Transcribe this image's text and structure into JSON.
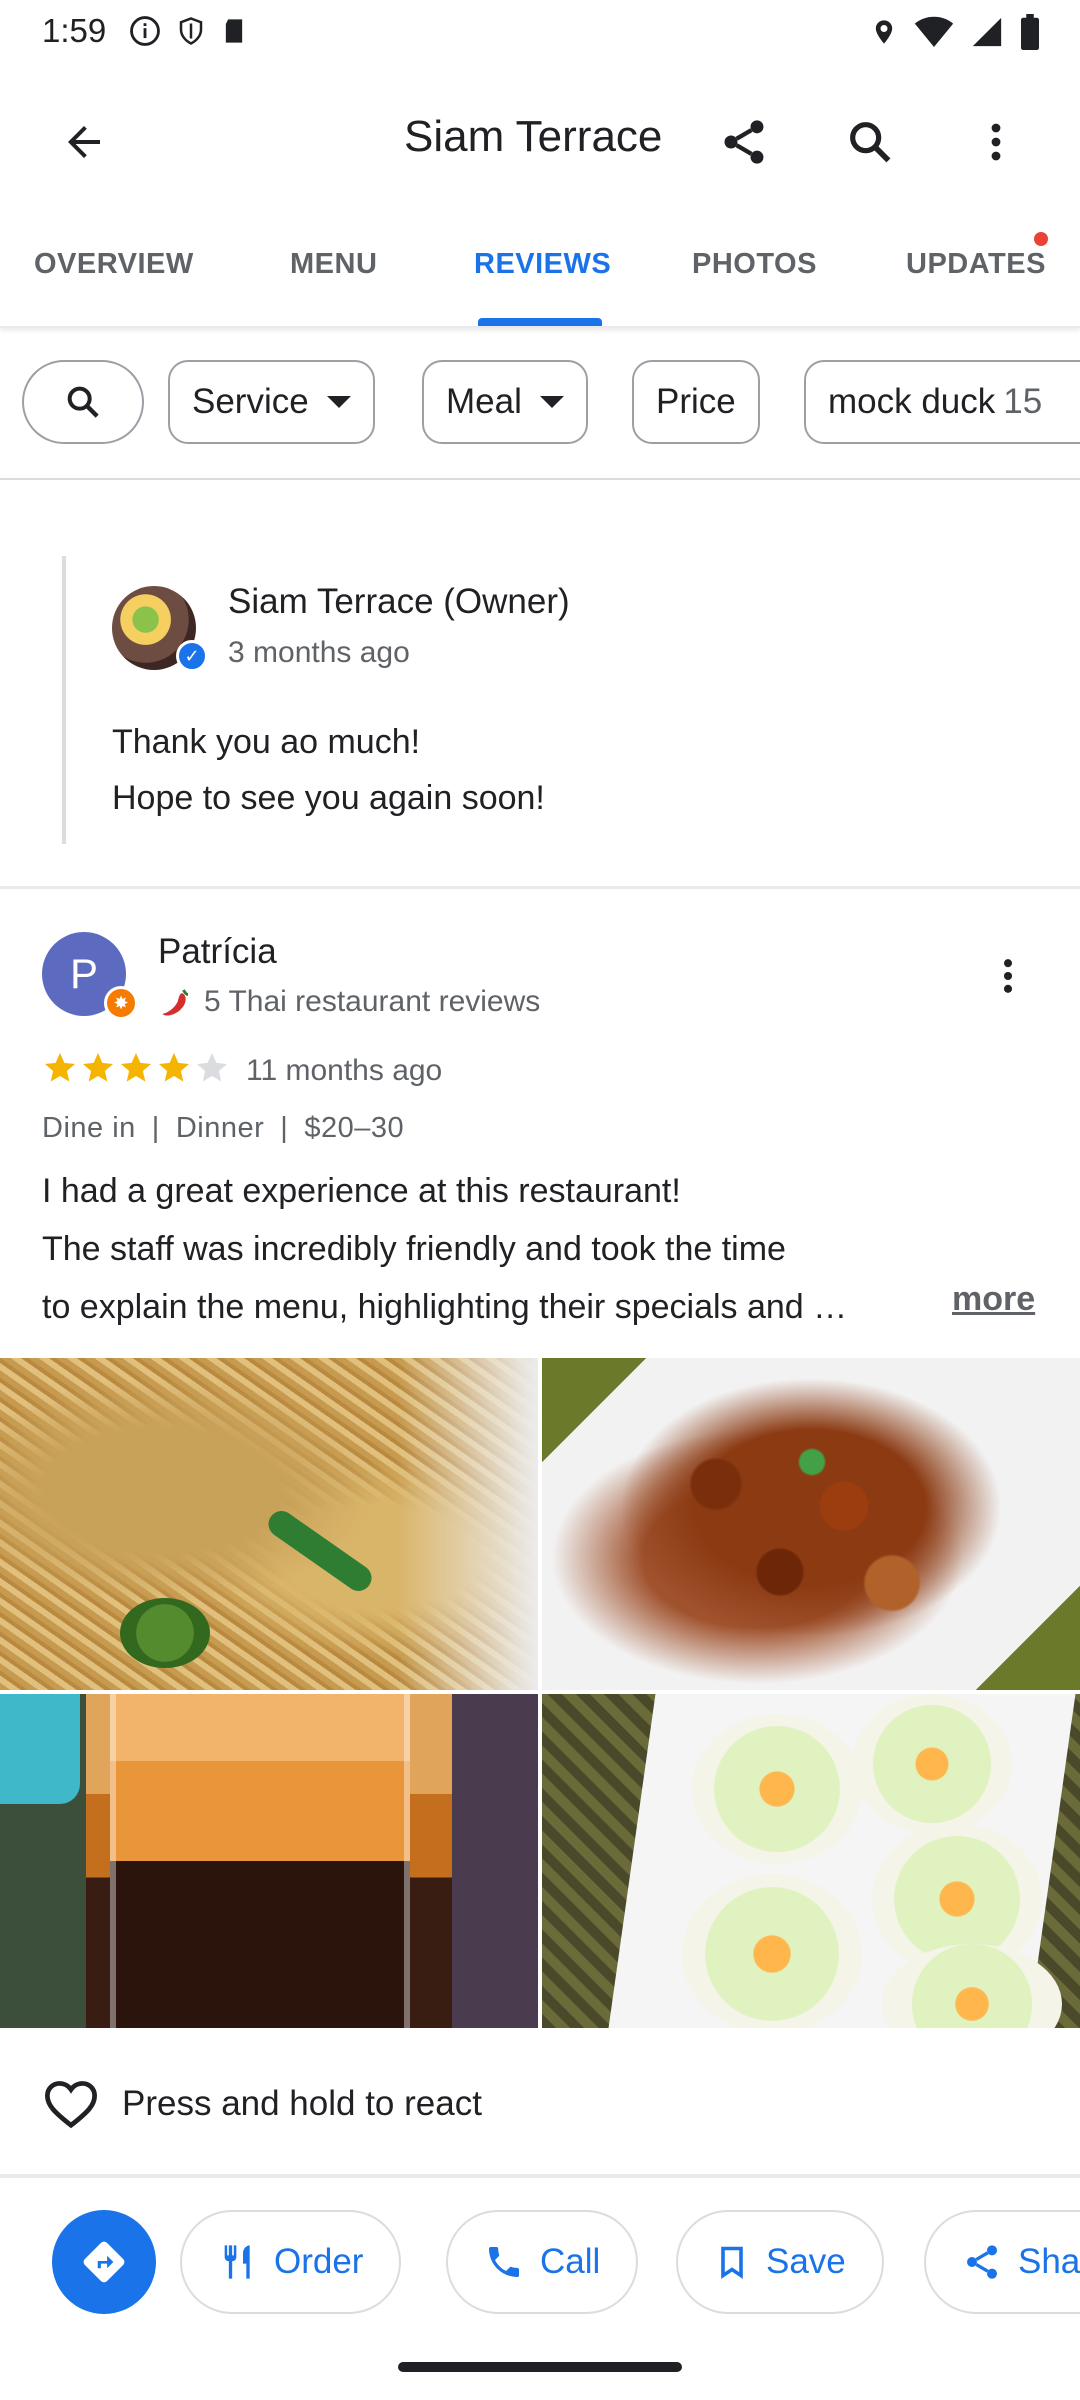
{
  "status_bar": {
    "time": "1:59"
  },
  "header": {
    "title": "Siam Terrace"
  },
  "tabs": [
    {
      "label": "OVERVIEW"
    },
    {
      "label": "MENU"
    },
    {
      "label": "REVIEWS"
    },
    {
      "label": "PHOTOS"
    },
    {
      "label": "UPDATES"
    }
  ],
  "active_tab": "REVIEWS",
  "filters": {
    "service": "Service",
    "meal": "Meal",
    "price": "Price",
    "mock_duck": "mock duck",
    "mock_duck_count": "15"
  },
  "owner_reply": {
    "name": "Siam Terrace (Owner)",
    "time": "3 months ago",
    "line1": "Thank you ao much!",
    "line2": "Hope to see you again soon!"
  },
  "review": {
    "avatar_letter": "P",
    "author": "Patrícia",
    "meta": "5 Thai restaurant reviews",
    "rating": 4,
    "rating_max": 5,
    "time": "11 months ago",
    "tag_dine": "Dine in",
    "tag_meal": "Dinner",
    "tag_price": "$20–30",
    "text_line1": "I had a great experience at this restaurant!",
    "text_line2": "The staff was incredibly friendly and took the time",
    "text_line3": "to explain the menu, highlighting their specials and …",
    "more_label": "more"
  },
  "react_label": "Press and hold to react",
  "actions": {
    "order": "Order",
    "call": "Call",
    "save": "Save",
    "share": "Sha"
  },
  "colors": {
    "accent": "#1a73e8",
    "star": "#f4b400",
    "notification_dot": "#ea4335",
    "avatar": "#5c6bc0"
  }
}
